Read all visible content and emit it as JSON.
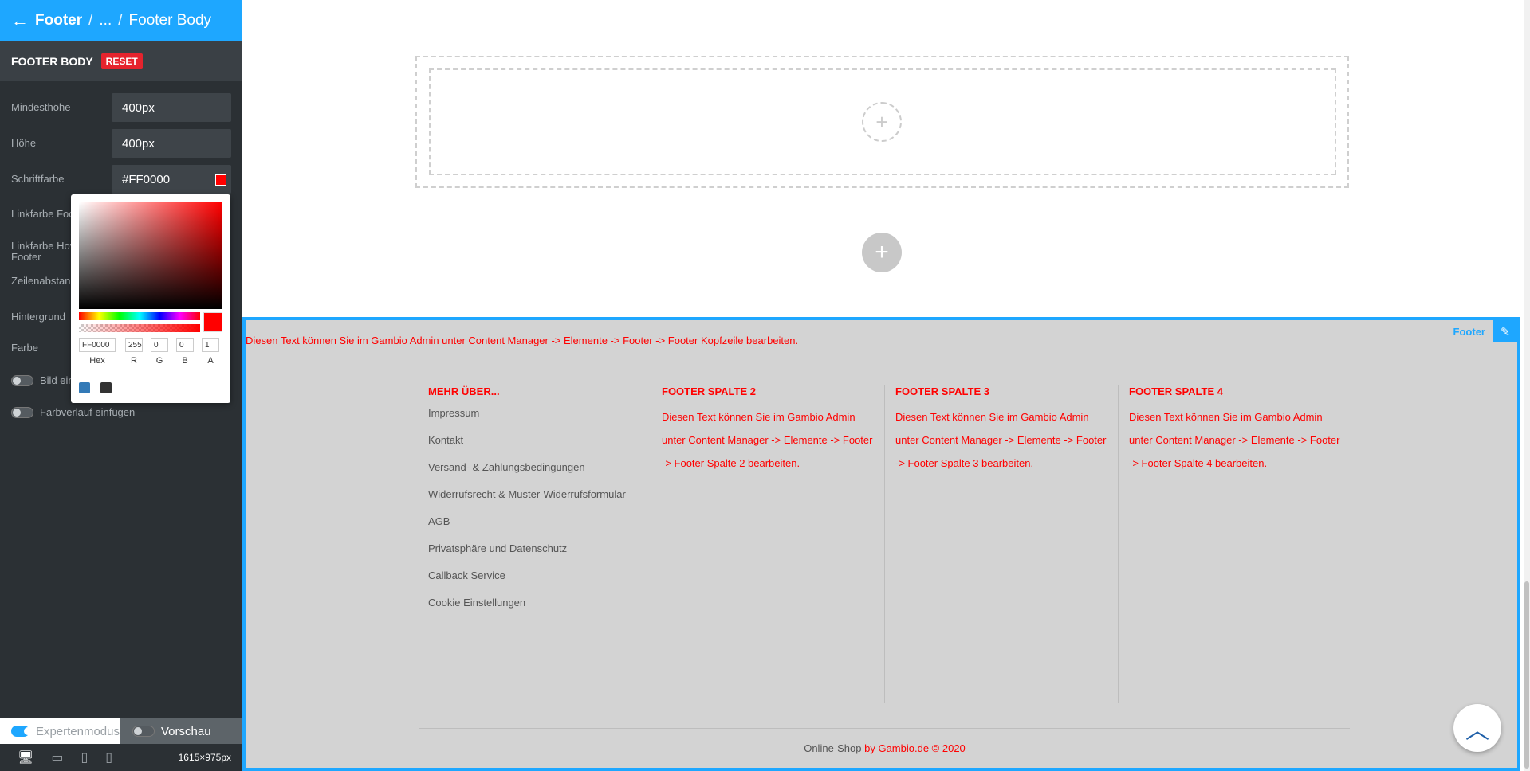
{
  "breadcrumb": {
    "parent": "Footer",
    "ellipsis": "...",
    "current": "Footer Body"
  },
  "section": {
    "title": "FOOTER BODY",
    "reset_label": "RESET"
  },
  "fields": [
    {
      "label": "Mindesthöhe",
      "value": "400px"
    },
    {
      "label": "Höhe",
      "value": "400px"
    },
    {
      "label": "Schriftfarbe",
      "value": "#FF0000"
    }
  ],
  "hidden_labels": {
    "link_color": "Linkfarbe Footer",
    "link_hover": "Linkfarbe Hover Footer",
    "line_height": "Zeilenabstand Footer",
    "background": "Hintergrund",
    "color": "Farbe",
    "image": "Bild ein"
  },
  "toggles": {
    "gradient": "Farbverlauf einfügen"
  },
  "picker": {
    "hex": "FF0000",
    "r": "255",
    "g": "0",
    "b": "0",
    "a": "1",
    "labels": {
      "hex": "Hex",
      "r": "R",
      "g": "G",
      "b": "B",
      "a": "A"
    },
    "presets": [
      "#337ab7",
      "#333333"
    ]
  },
  "modes": {
    "expert": "Expertenmodus",
    "preview": "Vorschau"
  },
  "device": {
    "dims": "1615×975px"
  },
  "footer": {
    "tag": "Footer",
    "header_note": "Diesen Text können Sie im Gambio Admin unter Content Manager -> Elemente -> Footer -> Footer Kopfzeile bearbeiten.",
    "col1": {
      "title": "MEHR ÜBER...",
      "links": [
        "Impressum",
        "Kontakt",
        "Versand- & Zahlungsbedingungen",
        "Widerrufsrecht & Muster-Widerrufsformular",
        "AGB",
        "Privatsphäre und Datenschutz",
        "Callback Service",
        "Cookie Einstellungen"
      ]
    },
    "col2": {
      "title": "FOOTER SPALTE 2",
      "text": "Diesen Text können Sie im Gambio Admin unter Content Manager -> Elemente -> Footer -> Footer Spalte 2 bearbeiten."
    },
    "col3": {
      "title": "FOOTER SPALTE 3",
      "text": "Diesen Text können Sie im Gambio Admin unter Content Manager -> Elemente -> Footer -> Footer Spalte 3 bearbeiten."
    },
    "col4": {
      "title": "FOOTER SPALTE 4",
      "text": "Diesen Text können Sie im Gambio Admin unter Content Manager -> Elemente -> Footer -> Footer Spalte 4 bearbeiten."
    },
    "copyright_prefix": "Online-Shop",
    "copyright_suffix": "by Gambio.de © 2020"
  }
}
